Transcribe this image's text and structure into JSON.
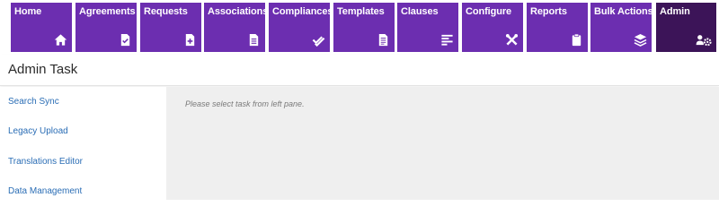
{
  "nav": {
    "tiles": [
      {
        "label": "Home",
        "icon": "home-icon"
      },
      {
        "label": "Agreements",
        "icon": "document-icon"
      },
      {
        "label": "Requests",
        "icon": "document-plus-icon"
      },
      {
        "label": "Associations",
        "icon": "document-lines-icon"
      },
      {
        "label": "Compliances",
        "icon": "double-check-icon"
      },
      {
        "label": "Templates",
        "icon": "template-icon"
      },
      {
        "label": "Clauses",
        "icon": "align-left-icon"
      },
      {
        "label": "Configure",
        "icon": "tools-icon"
      },
      {
        "label": "Reports",
        "icon": "clipboard-icon"
      },
      {
        "label": "Bulk Actions",
        "icon": "layers-icon"
      },
      {
        "label": "Admin",
        "icon": "users-gear-icon"
      }
    ],
    "active": "Admin",
    "tile_color": "#6c2eb0",
    "active_color": "#3c1458"
  },
  "page": {
    "title": "Admin Task"
  },
  "left_pane": {
    "tasks": [
      "Search Sync",
      "Legacy Upload",
      "Translations Editor",
      "Data Management"
    ]
  },
  "main": {
    "hint": "Please select task from left pane."
  }
}
